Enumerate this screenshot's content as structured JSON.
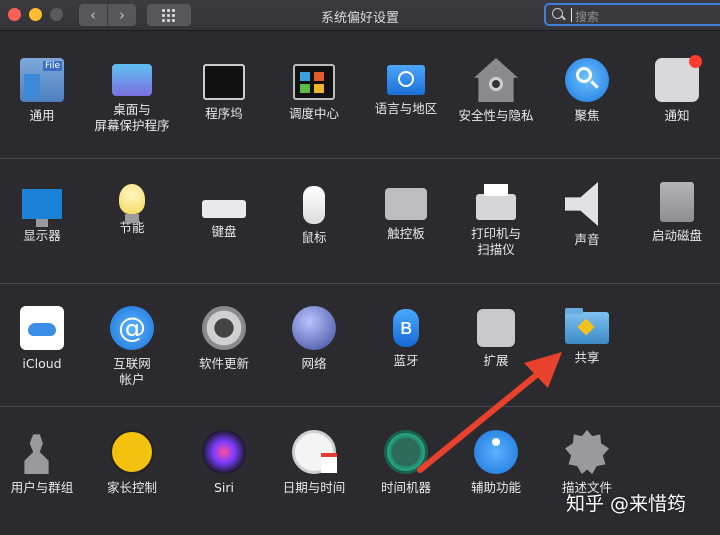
{
  "window": {
    "title": "系统偏好设置",
    "search_placeholder": "搜索",
    "back_glyph": "‹",
    "forward_glyph": "›"
  },
  "rows": [
    {
      "items": [
        {
          "label": "通用",
          "icon": "general-icon"
        },
        {
          "label": "桌面与\n屏幕保护程序",
          "icon": "desktop-screensaver-icon"
        },
        {
          "label": "程序坞",
          "icon": "dock-icon"
        },
        {
          "label": "调度中心",
          "icon": "mission-control-icon"
        },
        {
          "label": "语言与地区",
          "icon": "language-region-icon"
        },
        {
          "label": "安全性与隐私",
          "icon": "security-privacy-icon"
        },
        {
          "label": "聚焦",
          "icon": "spotlight-icon"
        },
        {
          "label": "通知",
          "icon": "notifications-icon"
        }
      ]
    },
    {
      "items": [
        {
          "label": "显示器",
          "icon": "displays-icon"
        },
        {
          "label": "节能",
          "icon": "energy-saver-icon"
        },
        {
          "label": "键盘",
          "icon": "keyboard-icon"
        },
        {
          "label": "鼠标",
          "icon": "mouse-icon"
        },
        {
          "label": "触控板",
          "icon": "trackpad-icon"
        },
        {
          "label": "打印机与\n扫描仪",
          "icon": "printers-scanners-icon"
        },
        {
          "label": "声音",
          "icon": "sound-icon"
        },
        {
          "label": "启动磁盘",
          "icon": "startup-disk-icon"
        }
      ]
    },
    {
      "items": [
        {
          "label": "iCloud",
          "icon": "icloud-icon"
        },
        {
          "label": "互联网\n帐户",
          "icon": "internet-accounts-icon"
        },
        {
          "label": "软件更新",
          "icon": "software-update-icon"
        },
        {
          "label": "网络",
          "icon": "network-icon"
        },
        {
          "label": "蓝牙",
          "icon": "bluetooth-icon"
        },
        {
          "label": "扩展",
          "icon": "extensions-icon"
        },
        {
          "label": "共享",
          "icon": "sharing-icon"
        }
      ]
    },
    {
      "items": [
        {
          "label": "用户与群组",
          "icon": "users-groups-icon"
        },
        {
          "label": "家长控制",
          "icon": "parental-controls-icon"
        },
        {
          "label": "Siri",
          "icon": "siri-icon"
        },
        {
          "label": "日期与时间",
          "icon": "date-time-icon"
        },
        {
          "label": "时间机器",
          "icon": "time-machine-icon"
        },
        {
          "label": "辅助功能",
          "icon": "accessibility-icon"
        },
        {
          "label": "描述文件",
          "icon": "profiles-icon"
        }
      ]
    }
  ],
  "annotation": {
    "arrow_color": "#e8412c"
  },
  "watermark": "知乎 @来惜筠",
  "colors": {
    "background": "#2b2a2f",
    "accent": "#3f7fd8"
  }
}
